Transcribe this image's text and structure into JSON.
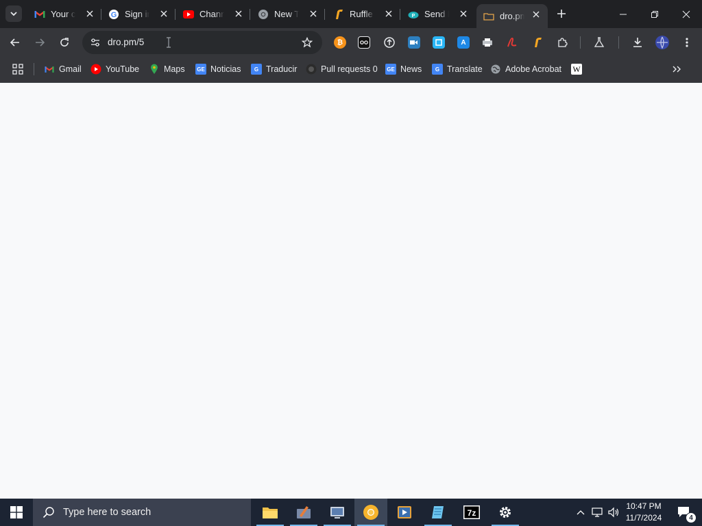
{
  "browser": {
    "tabs": [
      {
        "title": "Your cl",
        "icon": "gmail-icon",
        "active": false
      },
      {
        "title": "Sign in",
        "icon": "google-icon",
        "active": false
      },
      {
        "title": "Channe",
        "icon": "youtube-icon",
        "active": false
      },
      {
        "title": "New Ta",
        "icon": "chrome-icon",
        "active": false
      },
      {
        "title": "Ruffle",
        "icon": "ruffle-icon",
        "active": false
      },
      {
        "title": "Send le",
        "icon": "pushbullet-icon",
        "active": false
      },
      {
        "title": "dro.pm",
        "icon": "dropm-icon",
        "active": true
      }
    ],
    "omnibox": {
      "url": "dro.pm/5"
    },
    "extensions": [
      "bitcoin-ext",
      "eyes-ext",
      "circle-ext",
      "meet-ext",
      "square-ext",
      "translate-ext",
      "print-ext",
      "acrobat-ext",
      "ruffle-ext",
      "puzzle-ext"
    ],
    "bookmarks": [
      {
        "label": "Gmail",
        "icon": "gmail-icon"
      },
      {
        "label": "YouTube",
        "icon": "youtube-icon"
      },
      {
        "label": "Maps",
        "icon": "maps-icon"
      },
      {
        "label": "Noticias",
        "icon": "google-news-icon"
      },
      {
        "label": "Traducir",
        "icon": "google-translate-icon"
      },
      {
        "label": "Pull requests 0",
        "icon": "github-icon"
      },
      {
        "label": "News",
        "icon": "google-news-icon"
      },
      {
        "label": "Translate",
        "icon": "google-translate-icon"
      },
      {
        "label": "Adobe Acrobat",
        "icon": "globe-icon"
      },
      {
        "label": "",
        "icon": "wikipedia-icon"
      }
    ]
  },
  "taskbar": {
    "search_placeholder": "Type here to search",
    "time": "10:47 PM",
    "date": "11/7/2024",
    "notification_count": "4"
  },
  "colors": {
    "chrome_dark": "#202124",
    "toolbar": "#35363a",
    "page_bg": "#f8f9fa",
    "taskbar": "#1c2433"
  }
}
